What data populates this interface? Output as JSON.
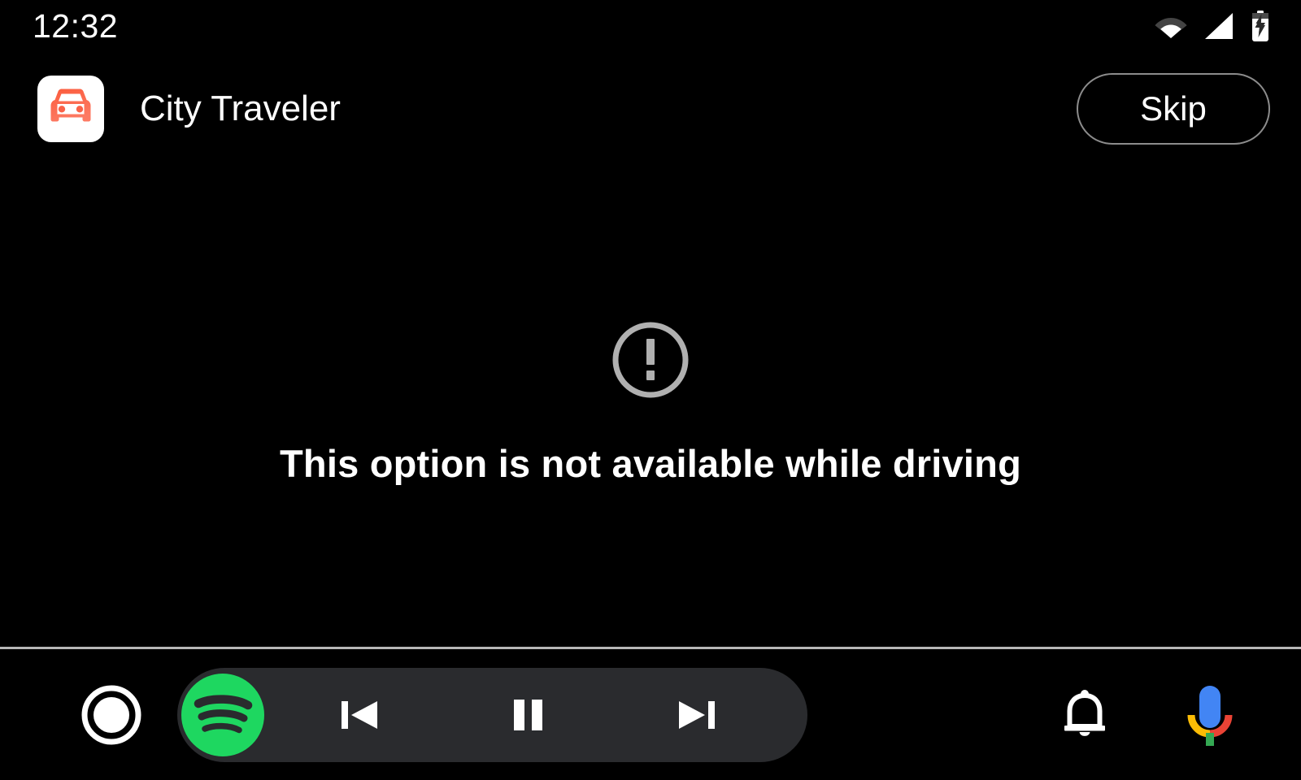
{
  "status_bar": {
    "clock": "12:32",
    "icons": [
      {
        "name": "wifi-icon",
        "label": "Wi-Fi"
      },
      {
        "name": "cellular-signal-icon",
        "label": "Cellular signal"
      },
      {
        "name": "battery-charging-icon",
        "label": "Battery charging"
      }
    ]
  },
  "header": {
    "app_icon_name": "car-app-icon",
    "app_title": "City Traveler",
    "skip_label": "Skip"
  },
  "content": {
    "alert_icon_name": "error-outline-icon",
    "message": "This option is not available while driving"
  },
  "nav_bar": {
    "home_label": "Home",
    "media_app": "Spotify",
    "previous_label": "Previous track",
    "pause_label": "Pause",
    "next_label": "Next track",
    "notifications_label": "Notifications",
    "assistant_label": "Google Assistant"
  },
  "colors": {
    "background": "#000000",
    "text": "#ffffff",
    "alert_gray": "#b0b0b0",
    "skip_border": "#8c8c8c",
    "media_pill": "#2a2b2e",
    "spotify_green": "#1ed760",
    "app_icon_accent": "#fc6a4f",
    "assistant_blue": "#4285f4",
    "assistant_yellow": "#fbbc05",
    "assistant_red": "#ea4335",
    "assistant_green": "#34a853",
    "divider": "#b8b8b8"
  }
}
